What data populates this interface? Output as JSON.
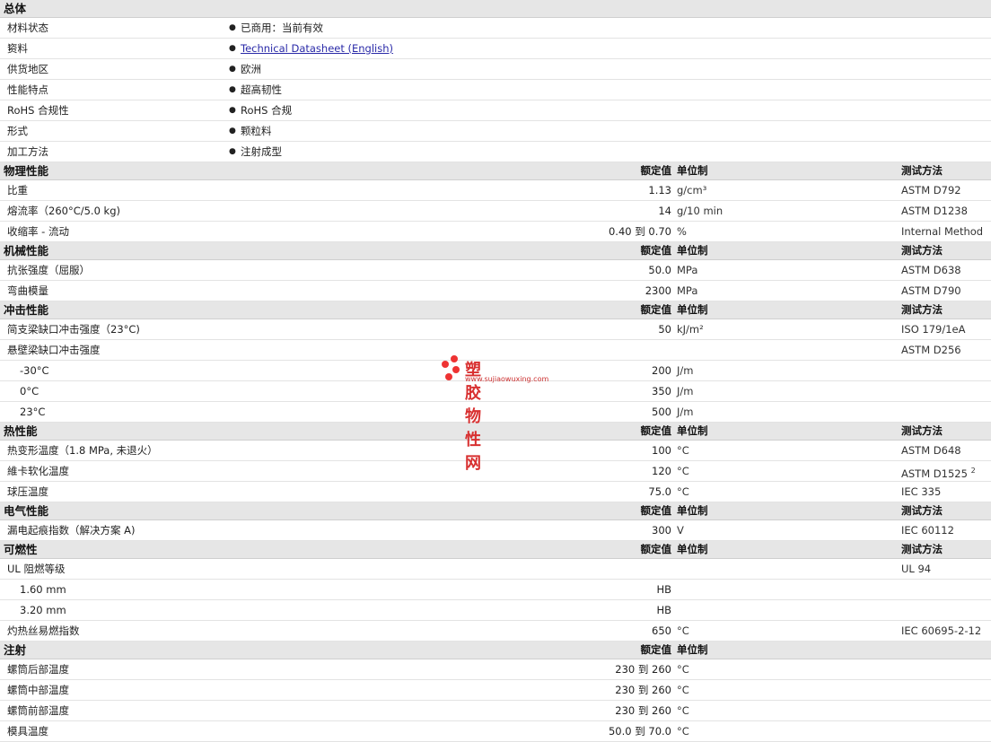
{
  "general": {
    "title": "总体",
    "rows": [
      {
        "label": "材料状态",
        "value": "已商用：当前有效"
      },
      {
        "label": "资料",
        "sup": "1",
        "value": "Technical Datasheet (English)",
        "link": true
      },
      {
        "label": "供货地区",
        "value": "欧洲"
      },
      {
        "label": "性能特点",
        "value": "超高韧性"
      },
      {
        "label": "RoHS 合规性",
        "value": "RoHS 合规"
      },
      {
        "label": "形式",
        "value": "颗粒料"
      },
      {
        "label": "加工方法",
        "value": "注射成型"
      }
    ]
  },
  "headers": {
    "value": "额定值",
    "unit": "单位制",
    "test": "测试方法"
  },
  "sections": [
    {
      "title": "物理性能",
      "has_test": true,
      "rows": [
        {
          "label": "比重",
          "value": "1.13",
          "unit": "g/cm³",
          "test": "ASTM D792"
        },
        {
          "label": "熔流率（260°C/5.0 kg)",
          "value": "14",
          "unit": "g/10 min",
          "test": "ASTM D1238"
        },
        {
          "label": "收缩率 - 流动",
          "value": "0.40 到  0.70",
          "unit": "%",
          "test": "Internal Method"
        }
      ]
    },
    {
      "title": "机械性能",
      "has_test": true,
      "rows": [
        {
          "label": "抗张强度（屈服）",
          "value": "50.0",
          "unit": "MPa",
          "test": "ASTM D638"
        },
        {
          "label": "弯曲模量",
          "value": "2300",
          "unit": "MPa",
          "test": "ASTM D790"
        }
      ]
    },
    {
      "title": "冲击性能",
      "has_test": true,
      "rows": [
        {
          "label": "简支梁缺口冲击强度（23°C)",
          "value": "50",
          "unit": "kJ/m²",
          "test": "ISO 179/1eA"
        },
        {
          "label": "悬壁梁缺口冲击强度",
          "value": "",
          "unit": "",
          "test": "ASTM D256"
        },
        {
          "label": "-30°C",
          "indent": true,
          "value": "200",
          "unit": "J/m",
          "test": ""
        },
        {
          "label": "0°C",
          "indent": true,
          "value": "350",
          "unit": "J/m",
          "test": ""
        },
        {
          "label": "23°C",
          "indent": true,
          "value": "500",
          "unit": "J/m",
          "test": ""
        }
      ]
    },
    {
      "title": "热性能",
      "has_test": true,
      "rows": [
        {
          "label": "热变形温度（1.8 MPa, 未退火）",
          "value": "100",
          "unit": "°C",
          "test": "ASTM D648"
        },
        {
          "label": "維卡软化温度",
          "value": "120",
          "unit": "°C",
          "test": "ASTM D1525",
          "test_sup": "2"
        },
        {
          "label": "球压温度",
          "value": "75.0",
          "unit": "°C",
          "test": "IEC 335"
        }
      ]
    },
    {
      "title": "电气性能",
      "has_test": true,
      "rows": [
        {
          "label": "漏电起痕指数（解决方案 A)",
          "value": "300",
          "unit": "V",
          "test": "IEC 60112"
        }
      ]
    },
    {
      "title": "可燃性",
      "has_test": true,
      "rows": [
        {
          "label": "UL 阻燃等级",
          "value": "",
          "unit": "",
          "test": "UL 94"
        },
        {
          "label": "1.60 mm",
          "indent": true,
          "value": "HB",
          "unit": "",
          "test": ""
        },
        {
          "label": "3.20 mm",
          "indent": true,
          "value": "HB",
          "unit": "",
          "test": ""
        },
        {
          "label": "灼热丝易燃指数",
          "value": "650",
          "unit": "°C",
          "test": "IEC 60695-2-12"
        }
      ]
    },
    {
      "title": "注射",
      "has_test": false,
      "rows": [
        {
          "label": "螺筒后部温度",
          "value": "230 到  260",
          "unit": "°C",
          "test": ""
        },
        {
          "label": "螺筒中部温度",
          "value": "230 到  260",
          "unit": "°C",
          "test": ""
        },
        {
          "label": "螺筒前部温度",
          "value": "230 到  260",
          "unit": "°C",
          "test": ""
        },
        {
          "label": "模具温度",
          "value": "50.0 到  70.0",
          "unit": "°C",
          "test": ""
        }
      ]
    }
  ],
  "watermark": {
    "title": "塑胶物性网",
    "url": "www.sujiaowuxing.com",
    "color": "#d83030"
  }
}
